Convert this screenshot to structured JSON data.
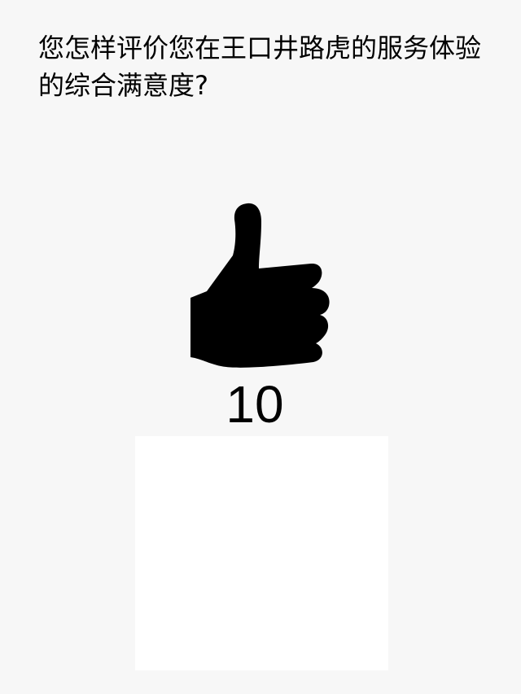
{
  "question": {
    "text": "您怎样评价您在王口井路虎的服务体验的综合满意度?"
  },
  "rating": {
    "icon": "thumbs-up-icon",
    "value": "10",
    "level": 1.0
  },
  "colors": {
    "background": "#f7f7f7",
    "panel": "#ffffff",
    "icon": "#000000"
  }
}
